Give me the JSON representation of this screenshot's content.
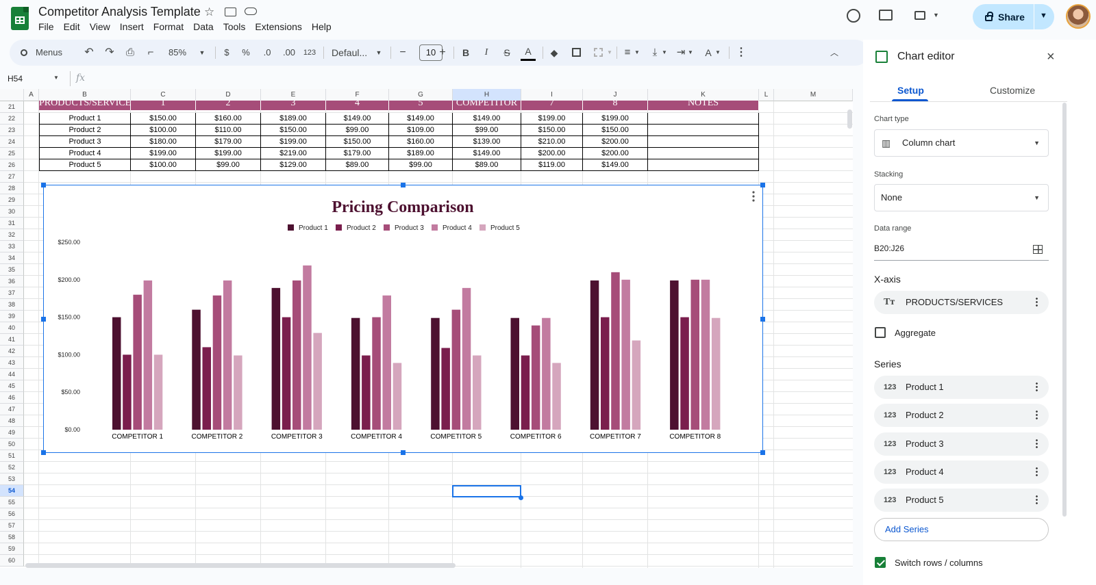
{
  "app": {
    "title": "Competitor Analysis Template",
    "menu": [
      "File",
      "Edit",
      "View",
      "Insert",
      "Format",
      "Data",
      "Tools",
      "Extensions",
      "Help"
    ],
    "share_label": "Share"
  },
  "toolbar": {
    "search_label": "Menus",
    "zoom": "85%",
    "currency": "$",
    "percent": "%",
    "dec_dec": ".0",
    "inc_dec": ".00",
    "format_num": "123",
    "font": "Defaul...",
    "font_size": "10",
    "bold": "B",
    "italic": "I",
    "strike": "S",
    "text_color": "A"
  },
  "formula_bar": {
    "cell_ref": "H54",
    "fx": "fx"
  },
  "grid": {
    "columns": [
      "A",
      "B",
      "C",
      "D",
      "E",
      "F",
      "G",
      "H",
      "I",
      "J",
      "K",
      "L",
      "M"
    ],
    "rows": [
      "21",
      "22",
      "23",
      "24",
      "25",
      "26",
      "27",
      "28",
      "29",
      "30",
      "31",
      "32",
      "33",
      "34",
      "35",
      "36",
      "37",
      "38",
      "39",
      "40",
      "41",
      "42",
      "43",
      "44",
      "45",
      "46",
      "47",
      "48",
      "49",
      "50",
      "51",
      "52",
      "53",
      "54",
      "55",
      "56",
      "57",
      "58",
      "59",
      "60"
    ],
    "header_row": [
      "PRODUCTS/SERVICES",
      "1",
      "2",
      "3",
      "4",
      "5",
      "COMPETITOR",
      "7",
      "8",
      "NOTES"
    ],
    "table": [
      [
        "Product 1",
        "$150.00",
        "$160.00",
        "$189.00",
        "$149.00",
        "$149.00",
        "$149.00",
        "$199.00",
        "$199.00"
      ],
      [
        "Product 2",
        "$100.00",
        "$110.00",
        "$150.00",
        "$99.00",
        "$109.00",
        "$99.00",
        "$150.00",
        "$150.00"
      ],
      [
        "Product 3",
        "$180.00",
        "$179.00",
        "$199.00",
        "$150.00",
        "$160.00",
        "$139.00",
        "$210.00",
        "$200.00"
      ],
      [
        "Product 4",
        "$199.00",
        "$199.00",
        "$219.00",
        "$179.00",
        "$189.00",
        "$149.00",
        "$200.00",
        "$200.00"
      ],
      [
        "Product 5",
        "$100.00",
        "$99.00",
        "$129.00",
        "$89.00",
        "$99.00",
        "$89.00",
        "$119.00",
        "$149.00"
      ]
    ]
  },
  "colors": {
    "p1": "#4d1130",
    "p2": "#7a1e4d",
    "p3": "#a64d79",
    "p4": "#c27ba0",
    "p5": "#d5a6bd",
    "header_fill": "#a64d79",
    "selection": "#1a73e8"
  },
  "chart_data": {
    "type": "bar",
    "title": "Pricing Comparison",
    "categories": [
      "COMPETITOR 1",
      "COMPETITOR 2",
      "COMPETITOR 3",
      "COMPETITOR 4",
      "COMPETITOR 5",
      "COMPETITOR 6",
      "COMPETITOR 7",
      "COMPETITOR 8"
    ],
    "series": [
      {
        "name": "Product 1",
        "values": [
          150,
          160,
          189,
          149,
          149,
          149,
          199,
          199
        ]
      },
      {
        "name": "Product 2",
        "values": [
          100,
          110,
          150,
          99,
          109,
          99,
          150,
          150
        ]
      },
      {
        "name": "Product 3",
        "values": [
          180,
          179,
          199,
          150,
          160,
          139,
          210,
          200
        ]
      },
      {
        "name": "Product 4",
        "values": [
          199,
          199,
          219,
          179,
          189,
          149,
          200,
          200
        ]
      },
      {
        "name": "Product 5",
        "values": [
          100,
          99,
          129,
          89,
          99,
          89,
          119,
          149
        ]
      }
    ],
    "yticks": [
      "$0.00",
      "$50.00",
      "$100.00",
      "$150.00",
      "$200.00",
      "$250.00"
    ],
    "ylim": [
      0,
      250
    ],
    "legend": "top",
    "grid": false
  },
  "editor": {
    "title": "Chart editor",
    "tabs": [
      "Setup",
      "Customize"
    ],
    "chart_type_label": "Chart type",
    "chart_type": "Column chart",
    "stacking_label": "Stacking",
    "stacking": "None",
    "data_range_label": "Data range",
    "data_range": "B20:J26",
    "xaxis_label": "X-axis",
    "xaxis_value": "PRODUCTS/SERVICES",
    "aggregate_label": "Aggregate",
    "series_label": "Series",
    "series": [
      "Product 1",
      "Product 2",
      "Product 3",
      "Product 4",
      "Product 5"
    ],
    "add_series": "Add Series",
    "switch_label": "Switch rows / columns",
    "switch_checked": true
  }
}
